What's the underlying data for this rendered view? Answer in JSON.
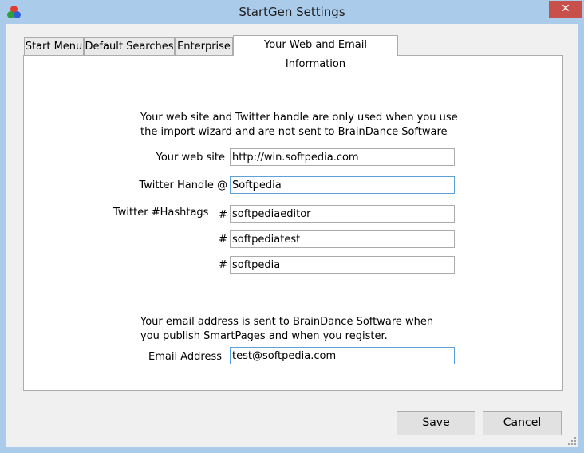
{
  "window": {
    "title": "StartGen Settings",
    "close_label": "✕"
  },
  "tabs": [
    {
      "label": "Start Menu",
      "active": false
    },
    {
      "label": "Default Searches",
      "active": false
    },
    {
      "label": "Enterprise",
      "active": false
    },
    {
      "label": "Your Web and Email Information",
      "active": true
    }
  ],
  "web_section": {
    "intro_line1": "Your web site and Twitter handle are only used when you use",
    "intro_line2": "the import wizard and are not sent to BrainDance Software",
    "website_label": "Your web site",
    "website_value": "http://win.softpedia.com",
    "twitter_label": "Twitter Handle @",
    "twitter_value": "Softpedia",
    "hashtags_label": "Twitter #Hashtags",
    "hash_symbol": "#",
    "hashtags": [
      "softpediaeditor",
      "softpediatest",
      "softpedia"
    ]
  },
  "email_section": {
    "intro_line1": "Your email address is sent to BrainDance Software when",
    "intro_line2": "you publish SmartPages and when you register.",
    "email_label": "Email Address",
    "email_value": "test@softpedia.com"
  },
  "buttons": {
    "save": "Save",
    "cancel": "Cancel"
  },
  "colors": {
    "frame": "#aacbea",
    "close": "#c7504b",
    "focus_border": "#5ea1d9"
  }
}
